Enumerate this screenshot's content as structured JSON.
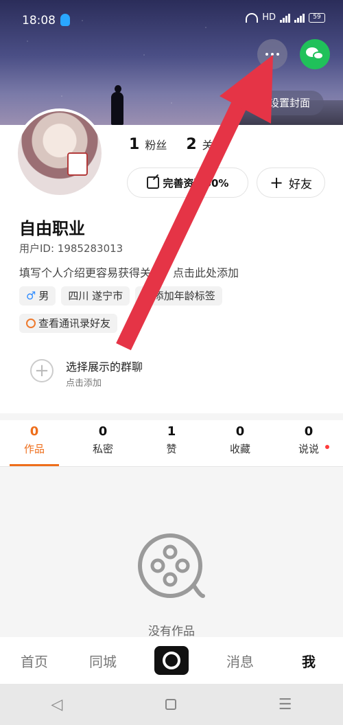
{
  "status_bar": {
    "time": "18:08",
    "network": "HD",
    "battery": "59"
  },
  "cover": {
    "set_cover_label": "设置封面"
  },
  "stats": {
    "fans_count": "1",
    "fans_label": "粉丝",
    "following_count": "2",
    "following_label": "关注"
  },
  "actions": {
    "complete_profile": "完善资料60%",
    "add_friend": "好友"
  },
  "profile": {
    "name": "自由职业",
    "user_id": "用户ID: 1985283013",
    "bio": "填写个人介绍更容易获得关注，点击此处添加",
    "tags": [
      "男",
      "四川 遂宁市",
      "添加年龄标签"
    ],
    "contacts": "查看通讯录好友"
  },
  "group": {
    "title": "选择展示的群聊",
    "subtitle": "点击添加"
  },
  "tabs": [
    {
      "count": "0",
      "label": "作品"
    },
    {
      "count": "0",
      "label": "私密"
    },
    {
      "count": "1",
      "label": "赞"
    },
    {
      "count": "0",
      "label": "收藏"
    },
    {
      "count": "0",
      "label": "说说"
    }
  ],
  "empty_state": {
    "text": "没有作品"
  },
  "bottom_nav": {
    "home": "首页",
    "city": "同城",
    "messages": "消息",
    "me": "我"
  },
  "colors": {
    "accent": "#ee6e1b",
    "arrow": "#e53446",
    "wechat": "#20c15a"
  }
}
